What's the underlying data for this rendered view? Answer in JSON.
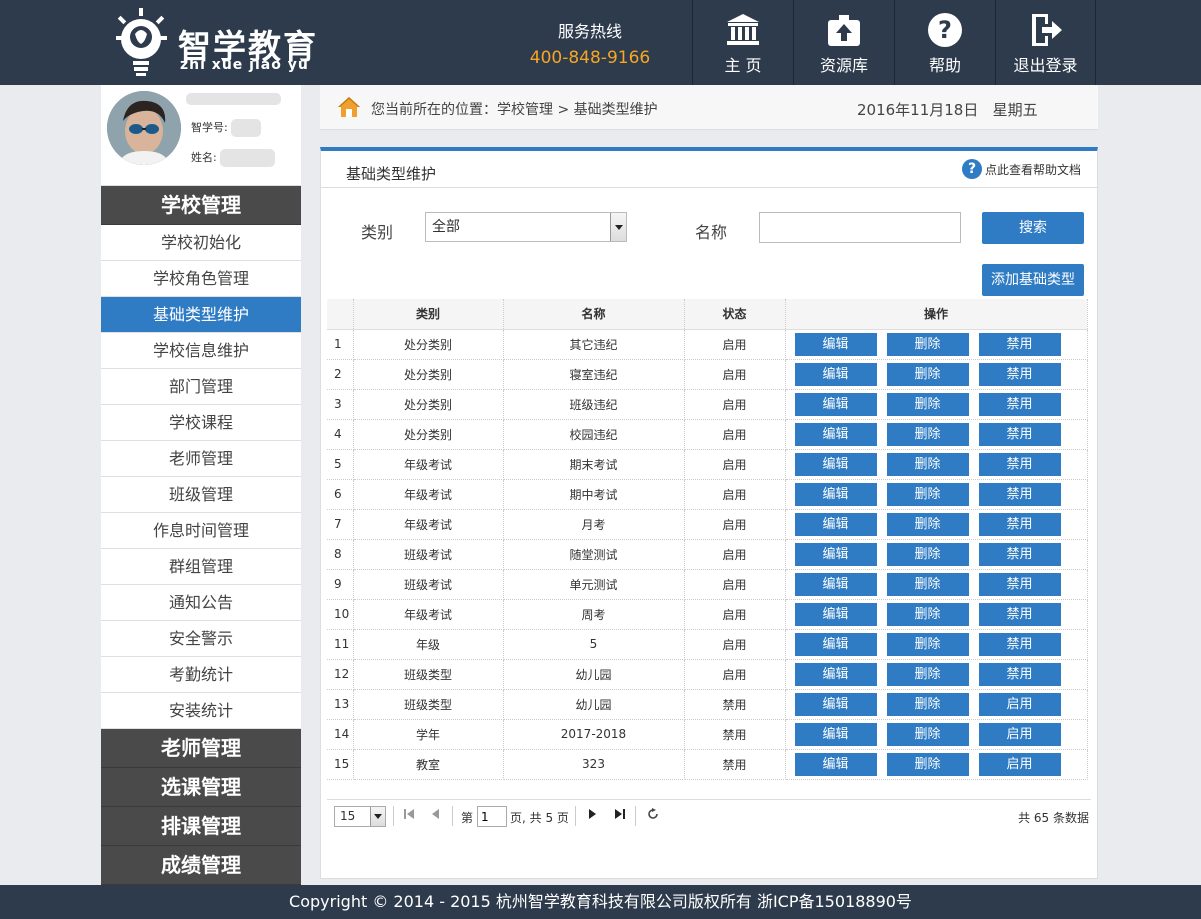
{
  "brand": {
    "name_cn": "智学教育",
    "name_en": "zhi xue jiao yu"
  },
  "hotline": {
    "label": "服务热线",
    "number": "400-848-9166"
  },
  "nav": [
    {
      "label": "主 页",
      "icon": "bank-icon"
    },
    {
      "label": "资源库",
      "icon": "upload-icon"
    },
    {
      "label": "帮助",
      "icon": "question-icon"
    },
    {
      "label": "退出登录",
      "icon": "logout-icon"
    }
  ],
  "profile": {
    "id_label": "智学号:",
    "name_label": "姓名:"
  },
  "sidebar": {
    "section_school": "学校管理",
    "items": [
      "学校初始化",
      "学校角色管理",
      "基础类型维护",
      "学校信息维护",
      "部门管理",
      "学校课程",
      "老师管理",
      "班级管理",
      "作息时间管理",
      "群组管理",
      "通知公告",
      "安全警示",
      "考勤统计",
      "安装统计"
    ],
    "active_index": 2,
    "sections": [
      "老师管理",
      "选课管理",
      "排课管理",
      "成绩管理"
    ]
  },
  "breadcrumb": {
    "text": "您当前所在的位置：学校管理 > 基础类型维护",
    "date": "2016年11月18日   星期五"
  },
  "panel": {
    "title": "基础类型维护",
    "help": "点此查看帮助文档",
    "filter_category_label": "类别",
    "filter_category_value": "全部",
    "filter_name_label": "名称",
    "filter_name_value": "",
    "search_button": "搜索",
    "add_button": "添加基础类型"
  },
  "table": {
    "columns": [
      "",
      "类别",
      "名称",
      "状态",
      "操作"
    ],
    "edit_label": "编辑",
    "delete_label": "删除",
    "rows": [
      {
        "n": "1",
        "category": "处分类别",
        "name": "其它违纪",
        "status": "启用",
        "toggle": "禁用"
      },
      {
        "n": "2",
        "category": "处分类别",
        "name": "寝室违纪",
        "status": "启用",
        "toggle": "禁用"
      },
      {
        "n": "3",
        "category": "处分类别",
        "name": "班级违纪",
        "status": "启用",
        "toggle": "禁用"
      },
      {
        "n": "4",
        "category": "处分类别",
        "name": "校园违纪",
        "status": "启用",
        "toggle": "禁用"
      },
      {
        "n": "5",
        "category": "年级考试",
        "name": "期末考试",
        "status": "启用",
        "toggle": "禁用"
      },
      {
        "n": "6",
        "category": "年级考试",
        "name": "期中考试",
        "status": "启用",
        "toggle": "禁用"
      },
      {
        "n": "7",
        "category": "年级考试",
        "name": "月考",
        "status": "启用",
        "toggle": "禁用"
      },
      {
        "n": "8",
        "category": "班级考试",
        "name": "随堂测试",
        "status": "启用",
        "toggle": "禁用"
      },
      {
        "n": "9",
        "category": "班级考试",
        "name": "单元测试",
        "status": "启用",
        "toggle": "禁用"
      },
      {
        "n": "10",
        "category": "年级考试",
        "name": "周考",
        "status": "启用",
        "toggle": "禁用"
      },
      {
        "n": "11",
        "category": "年级",
        "name": "5",
        "status": "启用",
        "toggle": "禁用"
      },
      {
        "n": "12",
        "category": "班级类型",
        "name": "幼儿园",
        "status": "启用",
        "toggle": "禁用"
      },
      {
        "n": "13",
        "category": "班级类型",
        "name": "幼儿园",
        "status": "禁用",
        "toggle": "启用"
      },
      {
        "n": "14",
        "category": "学年",
        "name": "2017-2018",
        "status": "禁用",
        "toggle": "启用"
      },
      {
        "n": "15",
        "category": "教室",
        "name": "323",
        "status": "禁用",
        "toggle": "启用"
      }
    ]
  },
  "pager": {
    "page_size": "15",
    "page_prefix": "第",
    "page_value": "1",
    "page_suffix": "页, 共 5 页",
    "total": "共 65 条数据"
  },
  "footer": {
    "text": "Copyright © 2014 - 2015 杭州智学教育科技有限公司版权所有 浙ICP备15018890号"
  },
  "colors": {
    "header_bg": "#2d3b4c",
    "accent": "#2f7cc4",
    "hotline": "#f6a623",
    "menu_head": "#4a4a4a"
  }
}
